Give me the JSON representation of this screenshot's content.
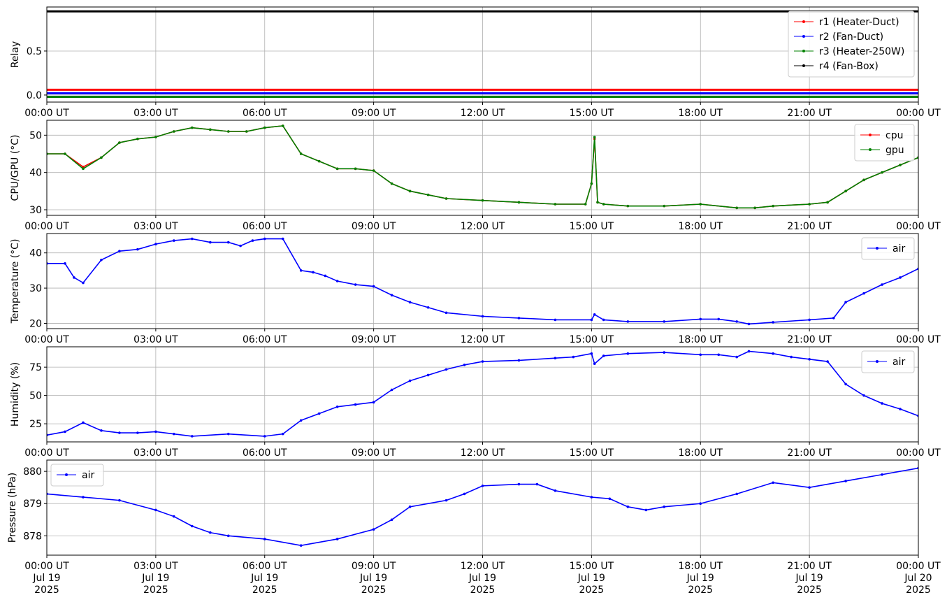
{
  "x_axis": {
    "tick_labels": [
      "00:00 UT",
      "03:00 UT",
      "06:00 UT",
      "09:00 UT",
      "12:00 UT",
      "15:00 UT",
      "18:00 UT",
      "21:00 UT",
      "00:00 UT"
    ],
    "bottom_date_lines": [
      [
        "Jul 19",
        "2025"
      ],
      [
        "Jul 19",
        "2025"
      ],
      [
        "Jul 19",
        "2025"
      ],
      [
        "Jul 19",
        "2025"
      ],
      [
        "Jul 19",
        "2025"
      ],
      [
        "Jul 19",
        "2025"
      ],
      [
        "Jul 19",
        "2025"
      ],
      [
        "Jul 19",
        "2025"
      ],
      [
        "Jul 20",
        "2025"
      ]
    ]
  },
  "chart_data": [
    {
      "type": "line",
      "ylabel": "Relay",
      "xlim": [
        "2025-07-19 00:00 UT",
        "2025-07-20 00:00 UT"
      ],
      "ylim": [
        -0.08,
        1.0
      ],
      "yticks": [
        0.0,
        0.5
      ],
      "ytick_labels": [
        "0.0",
        "0.5"
      ],
      "grid": true,
      "legend_position": "top-right",
      "series": [
        {
          "name": "r1 (Heater-Duct)",
          "color": "#ff0000",
          "x": [
            "00:00",
            "24:00"
          ],
          "y": [
            0.06,
            0.06
          ]
        },
        {
          "name": "r2 (Fan-Duct)",
          "color": "#0000ff",
          "x": [
            "00:00",
            "24:00"
          ],
          "y": [
            0.02,
            0.02
          ]
        },
        {
          "name": "r3 (Heater-250W)",
          "color": "#008000",
          "x": [
            "00:00",
            "24:00"
          ],
          "y": [
            -0.02,
            -0.02
          ]
        },
        {
          "name": "r4 (Fan-Box)",
          "color": "#000000",
          "x": [
            "00:00",
            "24:00"
          ],
          "y": [
            0.95,
            0.95
          ]
        }
      ]
    },
    {
      "type": "line",
      "ylabel": "CPU/GPU (°C)",
      "xlim": [
        "2025-07-19 00:00 UT",
        "2025-07-20 00:00 UT"
      ],
      "ylim": [
        28.5,
        54.0
      ],
      "yticks": [
        30,
        40,
        50
      ],
      "ytick_labels": [
        "30",
        "40",
        "50"
      ],
      "grid": true,
      "legend_position": "top-right",
      "series": [
        {
          "name": "cpu",
          "color": "#ff0000",
          "x": [
            "00:00",
            "00:30",
            "01:00",
            "01:30",
            "02:00",
            "02:30",
            "03:00",
            "03:30",
            "04:00",
            "04:30",
            "05:00",
            "05:30",
            "06:00",
            "06:30",
            "07:00",
            "07:30",
            "08:00",
            "08:30",
            "09:00",
            "09:30",
            "10:00",
            "10:30",
            "11:00",
            "12:00",
            "13:00",
            "14:00",
            "14:50",
            "15:00",
            "15:05",
            "15:10",
            "15:20",
            "16:00",
            "17:00",
            "18:00",
            "19:00",
            "19:30",
            "20:00",
            "21:00",
            "21:30",
            "22:00",
            "22:30",
            "23:00",
            "23:30",
            "24:00"
          ],
          "y": [
            45,
            45,
            41.5,
            44,
            48,
            49,
            49.5,
            51,
            52,
            51.5,
            51,
            51,
            52,
            52.5,
            45,
            43,
            41,
            41,
            40.5,
            37,
            35,
            34,
            33,
            32.5,
            32,
            31.5,
            31.5,
            37,
            49,
            32,
            31.5,
            31,
            31,
            31.5,
            30.5,
            30.5,
            31,
            31.5,
            32,
            35,
            38,
            40,
            42,
            44
          ]
        },
        {
          "name": "gpu",
          "color": "#008000",
          "x": [
            "00:00",
            "00:30",
            "01:00",
            "01:30",
            "02:00",
            "02:30",
            "03:00",
            "03:30",
            "04:00",
            "04:30",
            "05:00",
            "05:30",
            "06:00",
            "06:30",
            "07:00",
            "07:30",
            "08:00",
            "08:30",
            "09:00",
            "09:30",
            "10:00",
            "10:30",
            "11:00",
            "12:00",
            "13:00",
            "14:00",
            "14:50",
            "15:00",
            "15:05",
            "15:10",
            "15:20",
            "16:00",
            "17:00",
            "18:00",
            "19:00",
            "19:30",
            "20:00",
            "21:00",
            "21:30",
            "22:00",
            "22:30",
            "23:00",
            "23:30",
            "24:00"
          ],
          "y": [
            45,
            45,
            41,
            44,
            48,
            49,
            49.5,
            51,
            52,
            51.5,
            51,
            51,
            52,
            52.5,
            45,
            43,
            41,
            41,
            40.5,
            37,
            35,
            34,
            33,
            32.5,
            32,
            31.5,
            31.5,
            37,
            49.5,
            32,
            31.5,
            31,
            31,
            31.5,
            30.5,
            30.5,
            31,
            31.5,
            32,
            35,
            38,
            40,
            42,
            44
          ]
        }
      ]
    },
    {
      "type": "line",
      "ylabel": "Temperature (°C)",
      "xlim": [
        "2025-07-19 00:00 UT",
        "2025-07-20 00:00 UT"
      ],
      "ylim": [
        18.5,
        45.5
      ],
      "yticks": [
        20,
        30,
        40
      ],
      "ytick_labels": [
        "20",
        "30",
        "40"
      ],
      "grid": true,
      "legend_position": "top-right",
      "series": [
        {
          "name": "air",
          "color": "#0000ff",
          "x": [
            "00:00",
            "00:30",
            "00:45",
            "01:00",
            "01:30",
            "02:00",
            "02:30",
            "03:00",
            "03:30",
            "04:00",
            "04:30",
            "05:00",
            "05:20",
            "05:40",
            "06:00",
            "06:30",
            "07:00",
            "07:20",
            "07:40",
            "08:00",
            "08:30",
            "09:00",
            "09:30",
            "10:00",
            "10:30",
            "11:00",
            "12:00",
            "13:00",
            "14:00",
            "15:00",
            "15:05",
            "15:20",
            "16:00",
            "17:00",
            "18:00",
            "18:30",
            "19:00",
            "19:20",
            "20:00",
            "21:00",
            "21:40",
            "22:00",
            "22:30",
            "23:00",
            "23:30",
            "24:00"
          ],
          "y": [
            37,
            37,
            33,
            31.5,
            38,
            40.5,
            41,
            42.5,
            43.5,
            44,
            43,
            43,
            42,
            43.5,
            44,
            44,
            35,
            34.5,
            33.5,
            32,
            31,
            30.5,
            28,
            26,
            24.5,
            23,
            22,
            21.5,
            21,
            21,
            22.5,
            21,
            20.5,
            20.5,
            21.2,
            21.2,
            20.5,
            19.8,
            20.3,
            21,
            21.5,
            26,
            28.5,
            31,
            33,
            35.5
          ]
        }
      ]
    },
    {
      "type": "line",
      "ylabel": "Humidity (%)",
      "xlim": [
        "2025-07-19 00:00 UT",
        "2025-07-20 00:00 UT"
      ],
      "ylim": [
        9,
        93
      ],
      "yticks": [
        25,
        50,
        75
      ],
      "ytick_labels": [
        "25",
        "50",
        "75"
      ],
      "grid": true,
      "legend_position": "top-right",
      "series": [
        {
          "name": "air",
          "color": "#0000ff",
          "x": [
            "00:00",
            "00:30",
            "01:00",
            "01:30",
            "02:00",
            "02:30",
            "03:00",
            "03:30",
            "04:00",
            "05:00",
            "06:00",
            "06:30",
            "07:00",
            "07:30",
            "08:00",
            "08:30",
            "09:00",
            "09:30",
            "10:00",
            "10:30",
            "11:00",
            "11:30",
            "12:00",
            "13:00",
            "14:00",
            "14:30",
            "15:00",
            "15:05",
            "15:20",
            "16:00",
            "17:00",
            "18:00",
            "18:30",
            "19:00",
            "19:20",
            "20:00",
            "20:30",
            "21:00",
            "21:30",
            "22:00",
            "22:30",
            "23:00",
            "23:30",
            "24:00"
          ],
          "y": [
            15,
            18,
            26,
            19,
            17,
            17,
            18,
            16,
            14,
            16,
            14,
            16,
            28,
            34,
            40,
            42,
            44,
            55,
            63,
            68,
            73,
            77,
            80,
            81,
            83,
            84,
            87,
            78,
            85,
            87,
            88,
            86,
            86,
            84,
            89,
            87,
            84,
            82,
            80,
            60,
            50,
            43,
            38,
            32
          ]
        }
      ]
    },
    {
      "type": "line",
      "ylabel": "Pressure (hPa)",
      "xlim": [
        "2025-07-19 00:00 UT",
        "2025-07-20 00:00 UT"
      ],
      "ylim": [
        877.4,
        880.35
      ],
      "yticks": [
        878,
        879,
        880
      ],
      "ytick_labels": [
        "878",
        "879",
        "880"
      ],
      "grid": true,
      "legend_position": "top-left",
      "series": [
        {
          "name": "air",
          "color": "#0000ff",
          "x": [
            "00:00",
            "01:00",
            "02:00",
            "03:00",
            "03:30",
            "04:00",
            "04:30",
            "05:00",
            "06:00",
            "07:00",
            "08:00",
            "09:00",
            "09:30",
            "10:00",
            "11:00",
            "11:30",
            "12:00",
            "13:00",
            "13:30",
            "14:00",
            "15:00",
            "15:30",
            "16:00",
            "16:30",
            "17:00",
            "18:00",
            "19:00",
            "20:00",
            "21:00",
            "22:00",
            "23:00",
            "24:00"
          ],
          "y": [
            879.3,
            879.2,
            879.1,
            878.8,
            878.6,
            878.3,
            878.1,
            878.0,
            877.9,
            877.7,
            877.9,
            878.2,
            878.5,
            878.9,
            879.1,
            879.3,
            879.55,
            879.6,
            879.6,
            879.4,
            879.2,
            879.15,
            878.9,
            878.8,
            878.9,
            879.0,
            879.3,
            879.65,
            879.5,
            879.7,
            879.9,
            880.1
          ]
        }
      ]
    }
  ]
}
